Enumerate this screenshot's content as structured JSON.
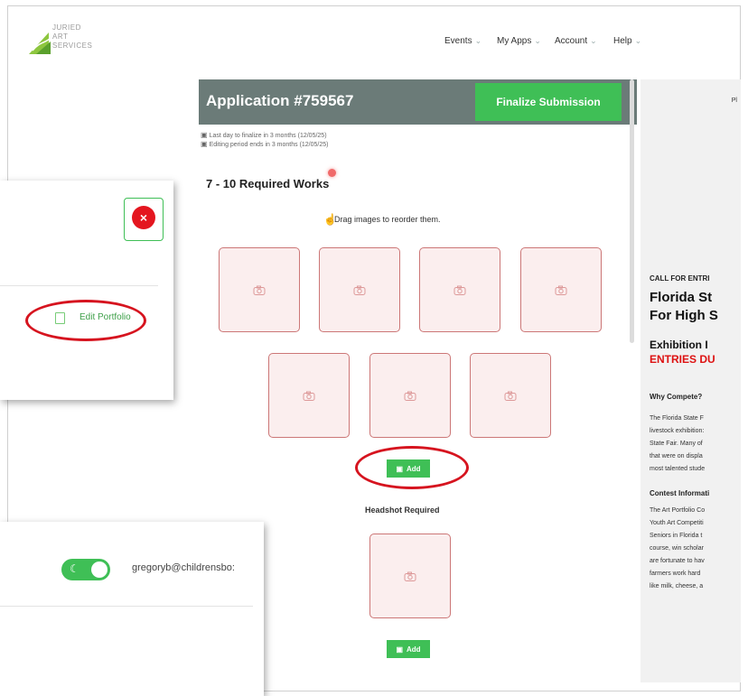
{
  "header": {
    "logo_text": [
      "JURIED",
      "ART",
      "SERVICES"
    ],
    "nav": [
      "Events",
      "My Apps",
      "Account",
      "Help"
    ]
  },
  "application": {
    "title": "Application #759567",
    "finalize_label": "Finalize Submission",
    "deadlines": [
      "Last day to finalize in 3 months (12/05/25)",
      "Editing period ends in 3 months (12/05/25)"
    ],
    "section_title": "7 - 10 Required Works",
    "drag_hint": "Drag images to reorder them.",
    "add_label": "Add",
    "headshot_title": "Headshot Required",
    "work_slot_count": 7
  },
  "right_panel": {
    "top_text": "Pl",
    "call": "CALL FOR ENTRI",
    "headline": [
      "Florida St",
      "For High S"
    ],
    "exhibition": "Exhibition I",
    "entries": "ENTRIES DU",
    "why": "Why Compete?",
    "why_lines": [
      "The Florida State F",
      "livestock exhibition:",
      "State Fair. Many of",
      "that were on displa",
      "most talented stude"
    ],
    "contest": "Contest Informati",
    "contest_lines": [
      "The Art Portfolio Co",
      "Youth Art Competiti",
      "Seniors in Florida t",
      "course, win scholar",
      "are fortunate to hav",
      "farmers work hard",
      "like milk, cheese, a"
    ]
  },
  "overlay_card_1": {
    "edit_label": "Edit Portfolio",
    "close_symbol": "×"
  },
  "overlay_card_2": {
    "email": "gregoryb@childrensbo:",
    "toggle_on": true
  },
  "colors": {
    "accent_green": "#3fbf56",
    "header_bar": "#6b7b78",
    "highlight_red": "#d6141f"
  }
}
